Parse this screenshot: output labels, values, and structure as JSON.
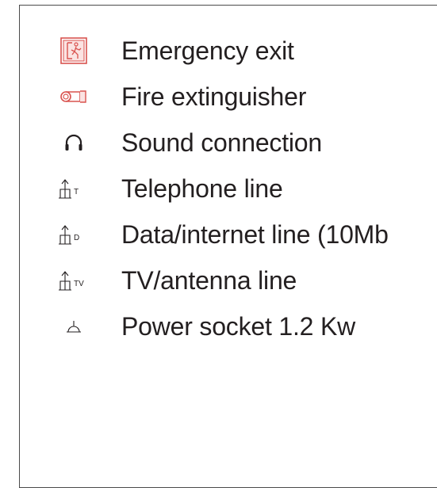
{
  "legend": {
    "items": [
      {
        "icon": "emergency-exit-icon",
        "icon_color": "#d9534f",
        "label": "Emergency exit"
      },
      {
        "icon": "fire-extinguisher-icon",
        "icon_color": "#d9534f",
        "label": "Fire extinguisher"
      },
      {
        "icon": "headphones-icon",
        "icon_color": "#231f20",
        "label": "Sound connection"
      },
      {
        "icon": "telephone-line-icon",
        "icon_color": "#231f20",
        "icon_letter": "T",
        "label": "Telephone line"
      },
      {
        "icon": "data-line-icon",
        "icon_color": "#231f20",
        "icon_letter": "D",
        "label": "Data/internet line (10Mb"
      },
      {
        "icon": "tv-antenna-line-icon",
        "icon_color": "#231f20",
        "icon_letter": "TV",
        "label": "TV/antenna line"
      },
      {
        "icon": "power-socket-icon",
        "icon_color": "#231f20",
        "label": "Power socket 1.2 Kw"
      }
    ]
  }
}
